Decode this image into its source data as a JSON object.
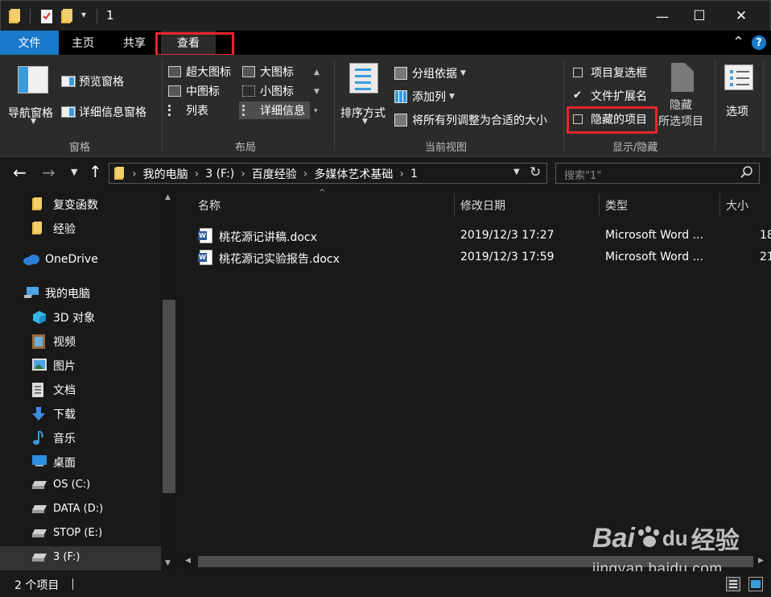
{
  "window": {
    "title": "1",
    "qat_dropdown": "▾",
    "minimize": "—",
    "maximize": "☐",
    "close": "✕"
  },
  "tabs": {
    "file": "文件",
    "home": "主页",
    "share": "共享",
    "view": "查看",
    "collapse": "⌃",
    "help": "?"
  },
  "ribbon": {
    "panes": {
      "nav_pane": "导航窗格",
      "preview_pane": "预览窗格",
      "details_pane": "详细信息窗格",
      "group": "窗格"
    },
    "layout": {
      "extra_large": "超大图标",
      "large": "大图标",
      "medium": "中图标",
      "small": "小图标",
      "list": "列表",
      "details": "详细信息",
      "group": "布局"
    },
    "current_view": {
      "sort_by": "排序方式",
      "group_by": "分组依据",
      "add_columns": "添加列",
      "size_all_columns": "将所有列调整为合适的大小",
      "group": "当前视图"
    },
    "show_hide": {
      "item_checkboxes": "项目复选框",
      "item_checkboxes_checked": false,
      "file_extensions": "文件扩展名",
      "file_extensions_checked": true,
      "hidden_items": "隐藏的项目",
      "hidden_items_checked": false,
      "hide_selected_1": "隐藏",
      "hide_selected_2": "所选项目",
      "group": "显示/隐藏"
    },
    "options": "选项"
  },
  "address": {
    "breadcrumb": [
      "我的电脑",
      "3 (F:)",
      "百度经验",
      "多媒体艺术基础",
      "1"
    ],
    "search_placeholder": "搜索\"1\""
  },
  "nav_pane": {
    "items": [
      {
        "label": "复变函数",
        "icon": "folder-icon"
      },
      {
        "label": "经验",
        "icon": "folder-icon"
      },
      {
        "label": "OneDrive",
        "icon": "onedrive-icon"
      },
      {
        "label": "我的电脑",
        "icon": "computer-icon"
      },
      {
        "label": "3D 对象",
        "icon": "3d-objects-icon"
      },
      {
        "label": "视频",
        "icon": "video-icon"
      },
      {
        "label": "图片",
        "icon": "pictures-icon"
      },
      {
        "label": "文档",
        "icon": "documents-icon"
      },
      {
        "label": "下载",
        "icon": "download-icon"
      },
      {
        "label": "音乐",
        "icon": "music-icon"
      },
      {
        "label": "桌面",
        "icon": "desktop-icon"
      },
      {
        "label": "OS (C:)",
        "icon": "drive-icon"
      },
      {
        "label": "DATA (D:)",
        "icon": "drive-icon"
      },
      {
        "label": "STOP (E:)",
        "icon": "drive-icon"
      },
      {
        "label": "3 (F:)",
        "icon": "drive-icon"
      }
    ]
  },
  "file_list": {
    "columns": [
      "名称",
      "修改日期",
      "类型",
      "大小"
    ],
    "rows": [
      {
        "name": "桃花源记讲稿.docx",
        "date": "2019/12/3 17:27",
        "type": "Microsoft Word ...",
        "size": "18"
      },
      {
        "name": "桃花源记实验报告.docx",
        "date": "2019/12/3 17:59",
        "type": "Microsoft Word ...",
        "size": "21"
      }
    ]
  },
  "status": {
    "count": "2 个项目"
  },
  "watermark": {
    "brand": "Bai",
    "brand2": "du",
    "suffix": "经验",
    "url": "jingyan.baidu.com"
  },
  "colors": {
    "accent": "#3a9bdc",
    "highlight_red": "#e8262b",
    "folder": "#e8b84a"
  }
}
